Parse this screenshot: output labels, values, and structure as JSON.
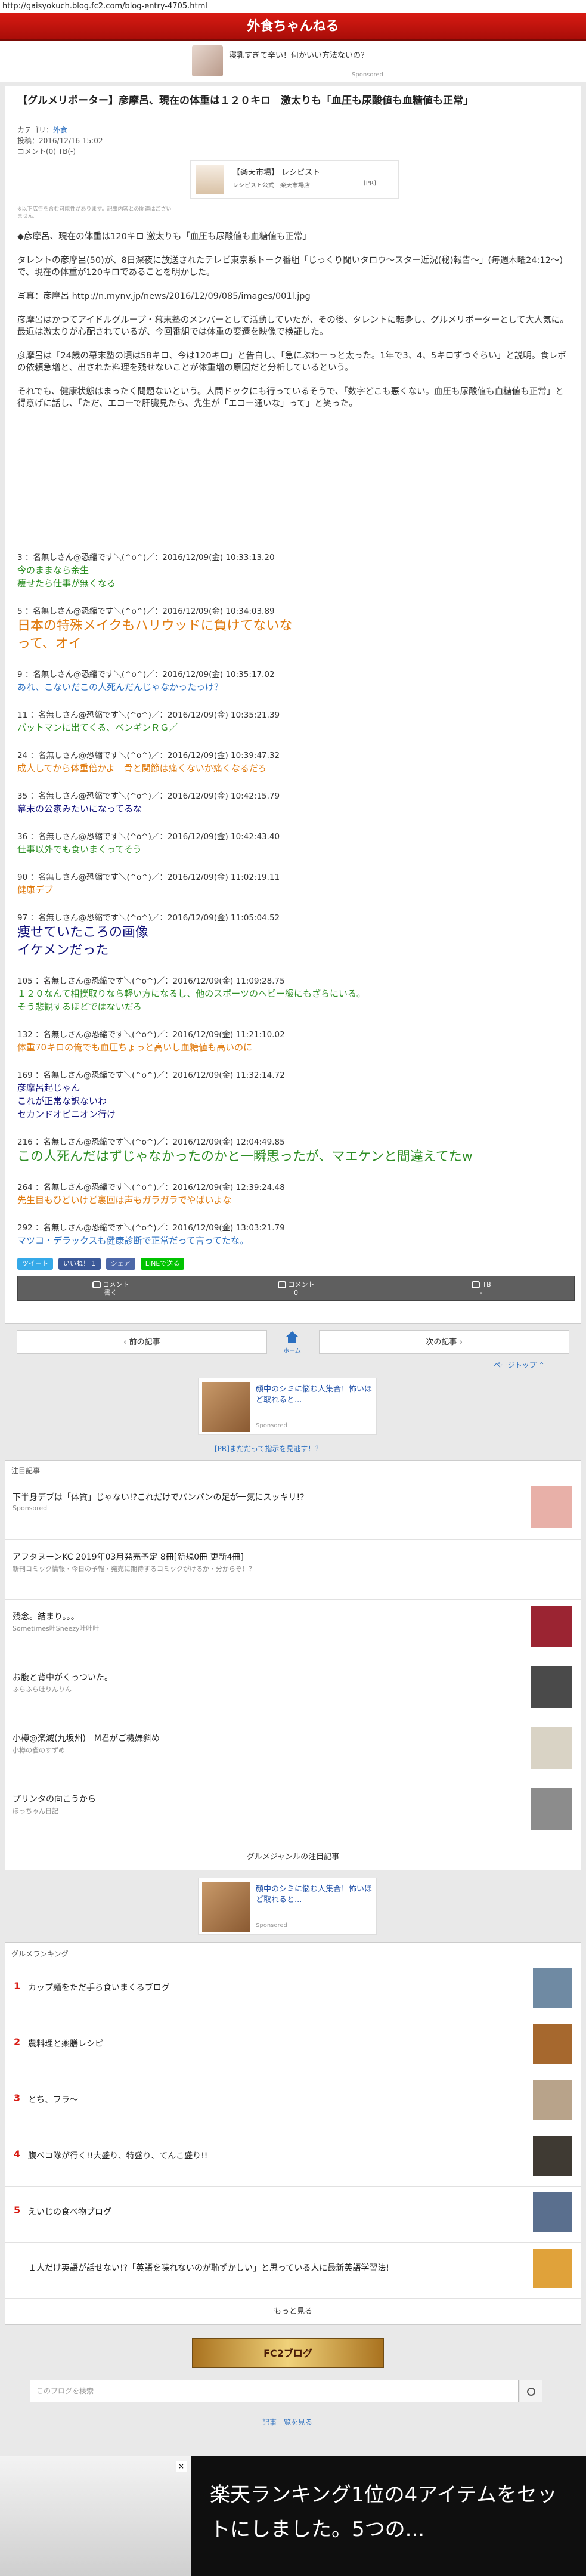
{
  "url": "http://gaisyokuch.blog.fc2.com/blog-entry-4705.html",
  "site_title": "外食ちゃんねる",
  "top_ad": {
    "text": "寝乳すぎて辛い！何かいい方法ないの？",
    "sponsored": "Sponsored"
  },
  "article": {
    "title": "【グルメリポーター】彦摩呂、現在の体重は１２０キロ　激太りも「血圧も尿酸値も血糖値も正常」",
    "category_label": "カテゴリ：",
    "category": "外食",
    "posted": "投稿：2016/12/16 15:02",
    "comments": "コメント(0)  TB(-)"
  },
  "rakuten_box": {
    "title": "【楽天市場】 レシピスト",
    "sub": "レシピスト公式　楽天市場店",
    "pr": "[PR]"
  },
  "disclaimer": "※以下広告を含む可能性があります。記事内容との関連はございません。",
  "body": [
    "◆彦摩呂、現在の体重は120キロ 激太りも「血圧も尿酸値も血糖値も正常」",
    "タレントの彦摩呂(50)が、8日深夜に放送されたテレビ東京系トーク番組「じっくり聞いタロウ〜スター近況(秘)報告〜」(毎週木曜24:12〜)で、現在の体重が120キロであることを明かした。",
    "写真：彦摩呂 http://n.mynv.jp/news/2016/12/09/085/images/001l.jpg",
    "彦摩呂はかつてアイドルグループ・幕末塾のメンバーとして活動していたが、その後、タレントに転身し、グルメリポーターとして大人気に。最近は激太りが心配されているが、今回番組では体重の変遷を映像で検証した。",
    "彦摩呂は「24歳の幕末塾の頃は58キロ、今は120キロ」と告白し、「急にぶわーっと太った。1年で3、4、5キロずつぐらい」と説明。食レポの依頼急増と、出された料理を残せないことが体重増の原因だと分析しているという。",
    "それでも、健康状態はまったく問題ないという。人間ドックにも行っているそうで、「数字どこも悪くない。血圧も尿酸値も血糖値も正常」と得意げに話し、「ただ、エコーで肝臓見たら、先生が「エコー通いな」って」と笑った。"
  ],
  "comments": [
    {
      "head": "3 ：名無しさん@恐縮です＼(^o^)／：2016/12/09(金) 10:33:13.20",
      "body": "今のままなら余生\n痩せたら仕事が無くなる",
      "color": "green",
      "big": false
    },
    {
      "head": "5 ：名無しさん@恐縮です＼(^o^)／：2016/12/09(金) 10:34:03.89",
      "body": "日本の特殊メイクもハリウッドに負けてないな\nって、オイ",
      "color": "orange",
      "big": true
    },
    {
      "head": "9 ：名無しさん@恐縮です＼(^o^)／：2016/12/09(金) 10:35:17.02",
      "body": "あれ、こないだこの人死んだんじゃなかったっけ？",
      "color": "blue",
      "big": false
    },
    {
      "head": "11 ：名無しさん@恐縮です＼(^o^)／：2016/12/09(金) 10:35:21.39",
      "body": "バットマンに出てくる、ペンギンＲＧ／",
      "color": "green",
      "big": false
    },
    {
      "head": "24 ：名無しさん@恐縮です＼(^o^)／：2016/12/09(金) 10:39:47.32",
      "body": "成人してから体重倍かよ　骨と関節は痛くないか痛くなるだろ",
      "color": "orange",
      "big": false
    },
    {
      "head": "35 ：名無しさん@恐縮です＼(^o^)／：2016/12/09(金) 10:42:15.79",
      "body": "幕末の公家みたいになってるな",
      "color": "navy",
      "big": false
    },
    {
      "head": "36 ：名無しさん@恐縮です＼(^o^)／：2016/12/09(金) 10:42:43.40",
      "body": "仕事以外でも食いまくってそう",
      "color": "green",
      "big": false
    },
    {
      "head": "90 ：名無しさん@恐縮です＼(^o^)／：2016/12/09(金) 11:02:19.11",
      "body": "健康デブ",
      "color": "orange",
      "big": false
    },
    {
      "head": "97 ：名無しさん@恐縮です＼(^o^)／：2016/12/09(金) 11:05:04.52",
      "body": "痩せていたころの画像\nイケメンだった",
      "color": "navy",
      "big": true
    },
    {
      "head": "105 ：名無しさん@恐縮です＼(^o^)／：2016/12/09(金) 11:09:28.75",
      "body": "１２０なんて相撲取りなら軽い方になるし、他のスポーツのヘビー級にもざらにいる。\nそう悲観するほどではないだろ",
      "color": "green",
      "big": false
    },
    {
      "head": "132 ：名無しさん@恐縮です＼(^o^)／：2016/12/09(金) 11:21:10.02",
      "body": "体重70キロの俺でも血圧ちょっと高いし血糖値も高いのに",
      "color": "orange",
      "big": false
    },
    {
      "head": "169 ：名無しさん@恐縮です＼(^o^)／：2016/12/09(金) 11:32:14.72",
      "body": "彦摩呂起じゃん\nこれが正常な訳ないわ\nセカンドオピニオン行け",
      "color": "navy",
      "big": false
    },
    {
      "head": "216 ：名無しさん@恐縮です＼(^o^)／：2016/12/09(金) 12:04:49.85",
      "body": "この人死んだはずじゃなかったのかと一瞬思ったが、マエケンと間違えてたw",
      "color": "green",
      "big": true
    },
    {
      "head": "264 ：名無しさん@恐縮です＼(^o^)／：2016/12/09(金) 12:39:24.48",
      "body": "先生目もひどいけど裏回は声もガラガラでやばいよな",
      "color": "orange",
      "big": false
    },
    {
      "head": "292 ：名無しさん@恐縮です＼(^o^)／：2016/12/09(金) 13:03:21.79",
      "body": "マツコ・デラックスも健康診断で正常だって言ってたな。",
      "color": "blue",
      "big": false
    }
  ],
  "share": {
    "tweet": "ツイート",
    "like": "いいね！ 1",
    "share": "シェア",
    "line": "LINEで送る"
  },
  "action_bar": {
    "comment_write": "コメント\n書く",
    "comment_count": "コメント\n0",
    "tb": "TB\n-"
  },
  "pager": {
    "prev": "前の記事",
    "home": "ホーム",
    "next": "次の記事"
  },
  "pagetop": "ページトップ",
  "mid_ad": {
    "text": "顔中のシミに悩む人集合！怖いほど取れると...",
    "sponsored": "Sponsored"
  },
  "pr_link": "[PR]まだだって指示を見逃す！？",
  "feed": {
    "label": "注目記事",
    "items": [
      {
        "title": "下半身デブは「体質」じゃない!?これだけでパンパンの足が一気にスッキリ!?",
        "sub": "Sponsored"
      },
      {
        "title": "アフタヌーンKC 2019年03月発売予定 8冊[新規0冊 更新4冊]",
        "sub": "新刊コミック情報・今日の予報・発売に期待するコミックがけるか・分からぞ！？"
      },
      {
        "title": "残念。結まり。。。",
        "sub": "Sometimes吐Sneezy吐吐吐"
      },
      {
        "title": "お腹と背中がくっついた。",
        "sub": "ふらふら吐りんりん"
      },
      {
        "title": "小樽@楽滅(九坂州)　M君がご機嫌斜め",
        "sub": "小樽の雀のすずめ"
      },
      {
        "title": "プリンタの向こうから",
        "sub": "ほっちゃん日記"
      }
    ],
    "foot": "グルメジャンルの注目記事"
  },
  "feed_ad2": {
    "text": "顔中のシミに悩む人集合！怖いほど取れると...",
    "sponsored": "Sponsored"
  },
  "ranking": {
    "label": "グルメランキング",
    "rows": [
      {
        "n": "1",
        "title": "カップ麺をただ手ら食いまくるブログ"
      },
      {
        "n": "2",
        "title": "農料理と薬膳レシピ"
      },
      {
        "n": "3",
        "title": "とち、フラ～"
      },
      {
        "n": "4",
        "title": "腹ペコ隊が行く!!大盛り、特盛り、てんこ盛り!!"
      },
      {
        "n": "5",
        "title": "えいじの食べ物ブログ"
      },
      {
        "n": "",
        "title": "１人だけ英語が話せない!?「英語を喋れないのが恥ずかしい」と思っている人に最新英語学習法!"
      }
    ],
    "foot": "もっと見る"
  },
  "banner": "FC2ブログ",
  "search": {
    "placeholder": "このブログを検索"
  },
  "list_link": "記事一覧を見る",
  "bottom_ad": {
    "text": "楽天ランキング1位の4アイテムをセットにしました。5つの...",
    "close": "×"
  },
  "colors": {
    "header": "#c3170f",
    "link": "#2b6fc0",
    "green": "#2f8f26",
    "orange": "#e07b10",
    "navy": "#12127a"
  }
}
